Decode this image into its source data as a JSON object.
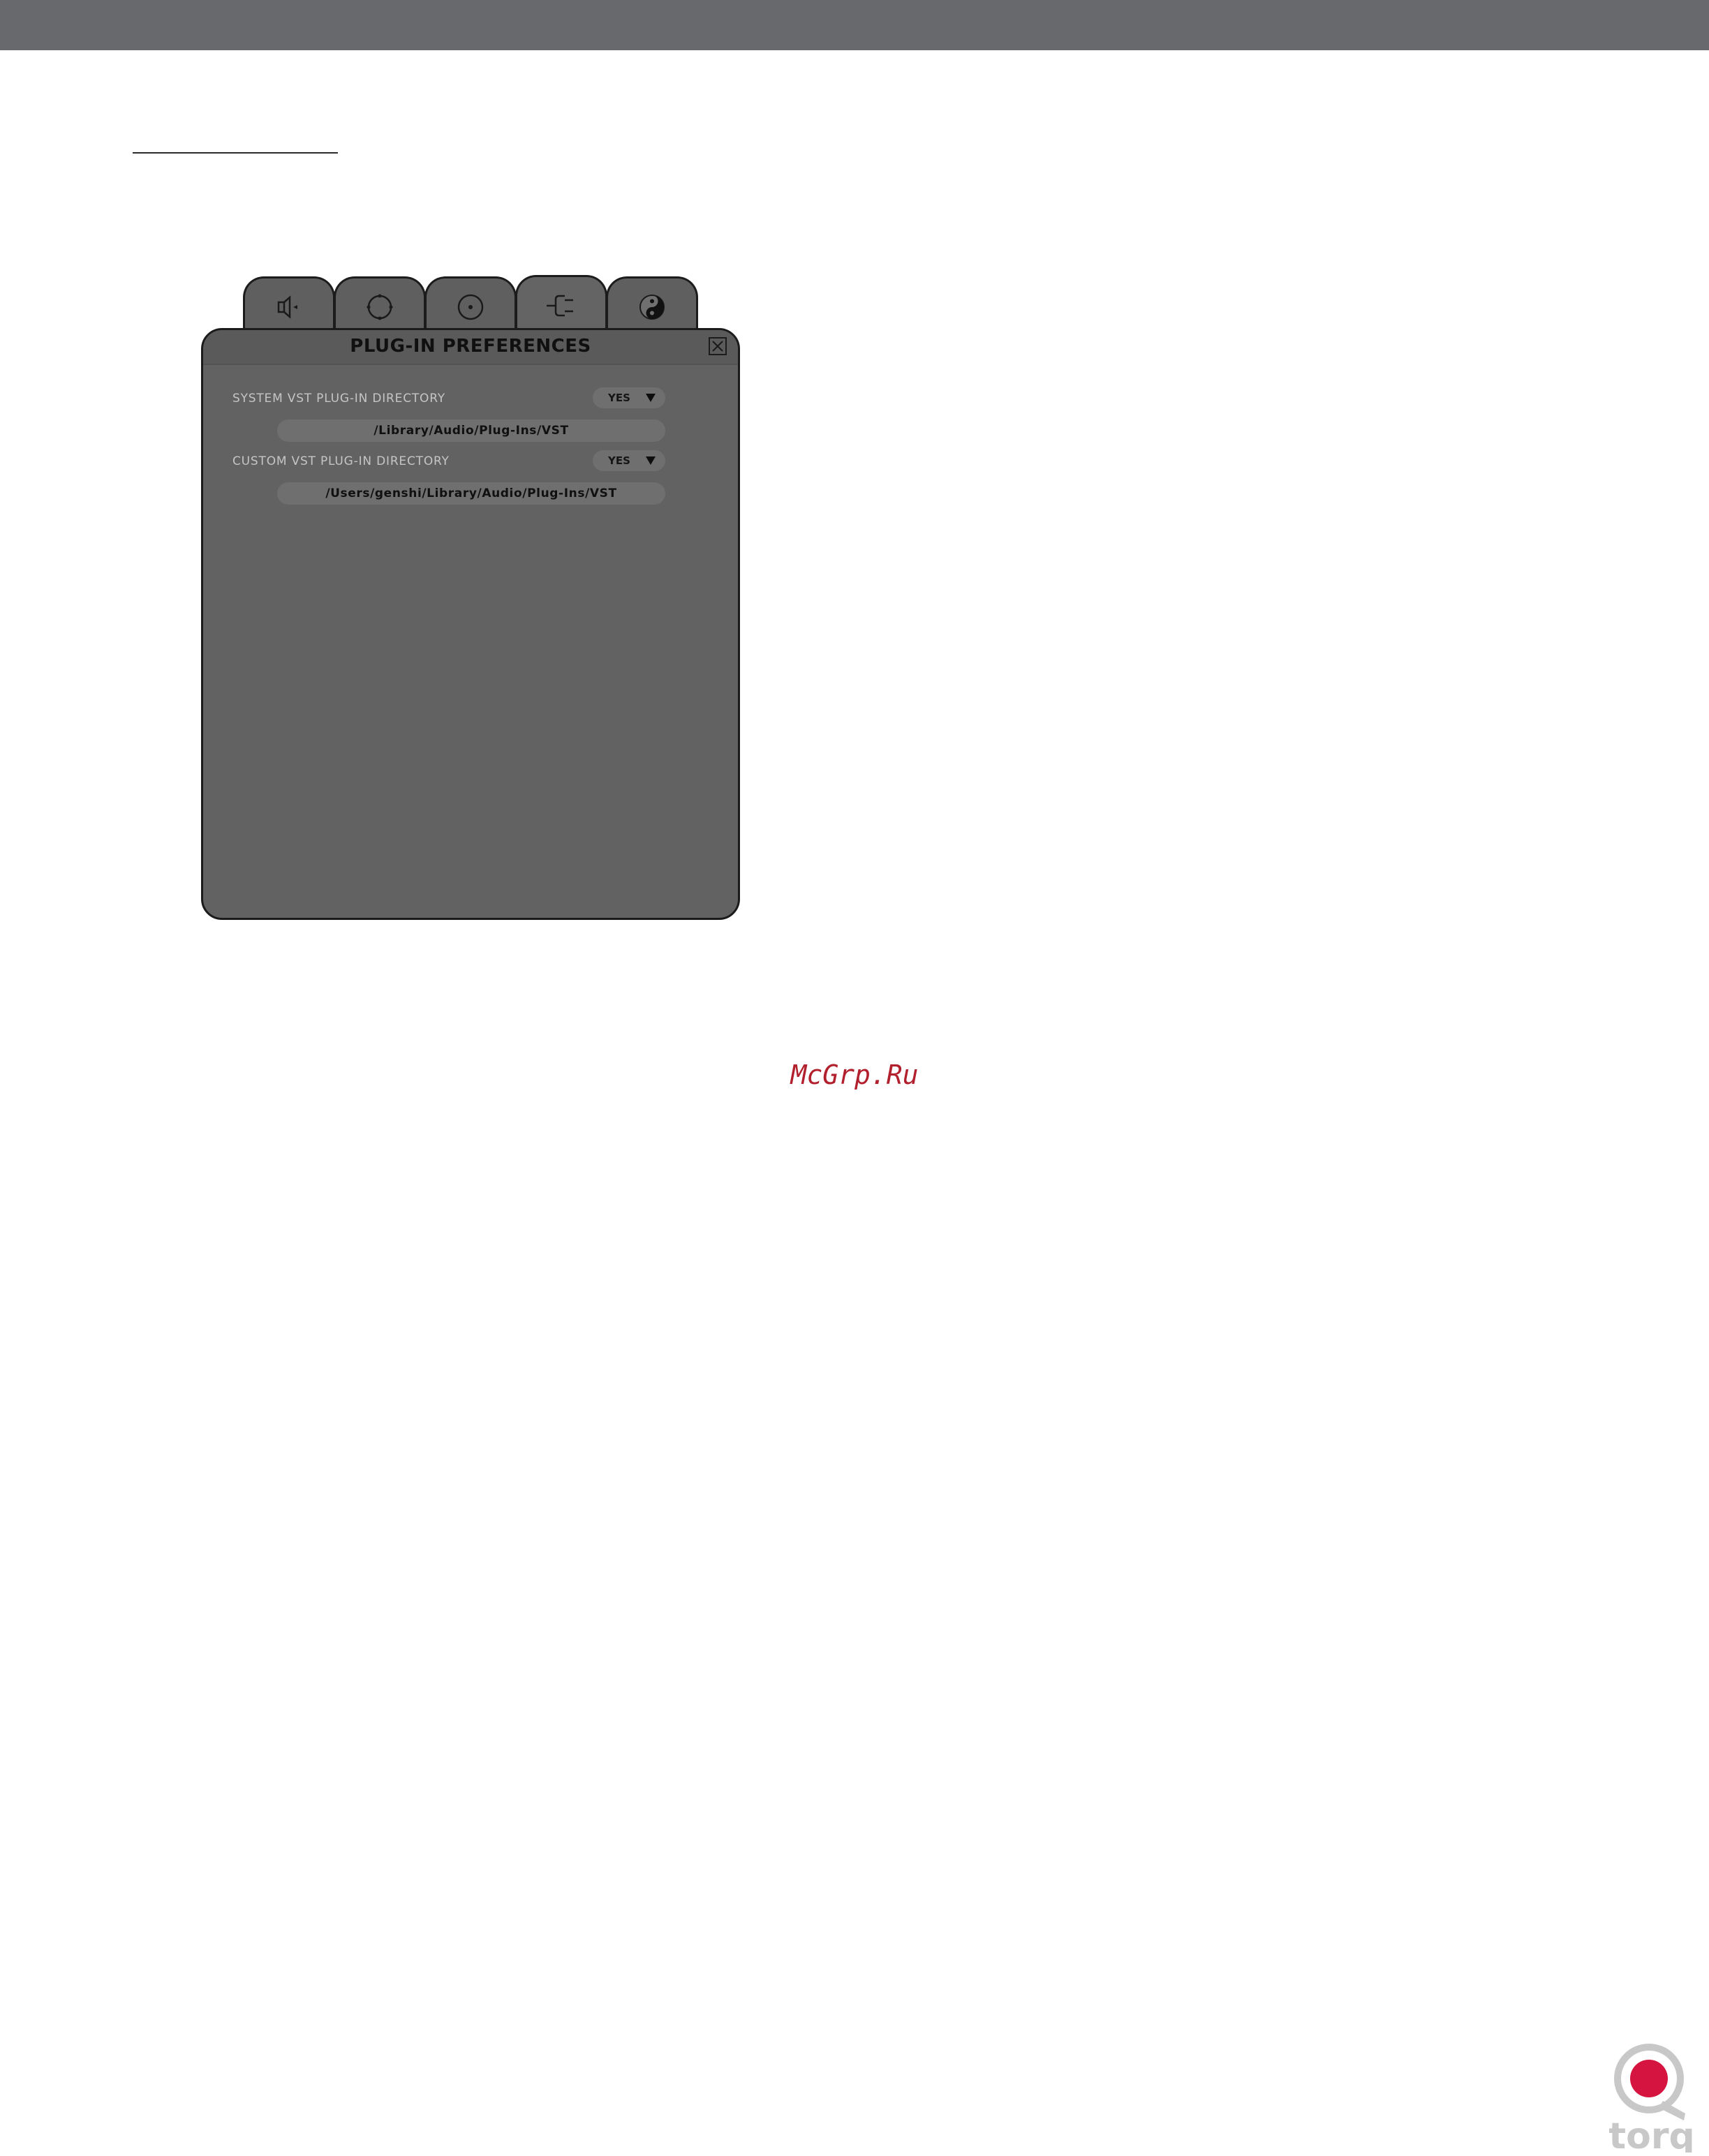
{
  "window": {
    "title": "PLUG-IN PREFERENCES"
  },
  "tabs": [
    {
      "icon": "speaker-icon"
    },
    {
      "icon": "dotted-circle-icon"
    },
    {
      "icon": "record-icon"
    },
    {
      "icon": "plug-icon",
      "active": true
    },
    {
      "icon": "yin-yang-icon"
    }
  ],
  "rows": [
    {
      "label": "SYSTEM VST PLUG-IN DIRECTORY",
      "dropdown_value": "YES",
      "path": "/Library/Audio/Plug-Ins/VST"
    },
    {
      "label": "CUSTOM VST PLUG-IN DIRECTORY",
      "dropdown_value": "YES",
      "path": "/Users/genshi/Library/Audio/Plug-Ins/VST"
    }
  ],
  "watermark": "McGrp.Ru",
  "logo": {
    "text": "torq",
    "accent_color": "#d5153f"
  },
  "colors": {
    "top_bar": "#67696d",
    "panel": "#626262",
    "field": "#6f6f6f"
  }
}
